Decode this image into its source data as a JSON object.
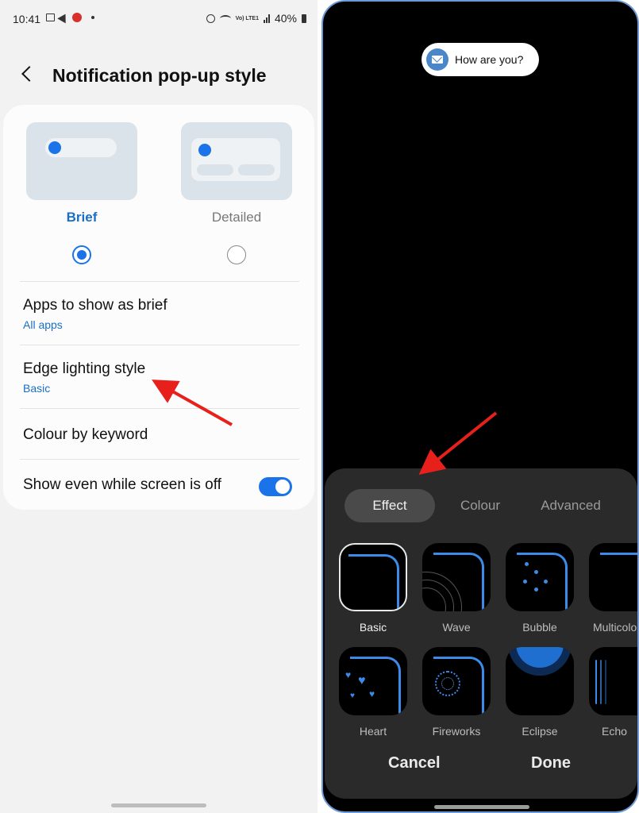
{
  "left_screen": {
    "status_bar": {
      "time": "10:41",
      "battery": "40%",
      "network": "Vo) LTE1"
    },
    "header": {
      "title": "Notification pop-up style"
    },
    "styles": [
      {
        "label": "Brief",
        "selected": true
      },
      {
        "label": "Detailed",
        "selected": false
      }
    ],
    "settings": [
      {
        "title": "Apps to show as brief",
        "subtitle": "All apps"
      },
      {
        "title": "Edge lighting style",
        "subtitle": "Basic"
      },
      {
        "title": "Colour by keyword"
      },
      {
        "title": "Show even while screen is off",
        "toggle": true
      }
    ]
  },
  "right_screen": {
    "preview_notification": "How are you?",
    "tabs": [
      "Effect",
      "Colour",
      "Advanced"
    ],
    "active_tab": "Effect",
    "effects": [
      "Basic",
      "Wave",
      "Bubble",
      "Multicolo",
      "Heart",
      "Fireworks",
      "Eclipse",
      "Echo"
    ],
    "selected_effect": "Basic",
    "buttons": {
      "cancel": "Cancel",
      "done": "Done"
    }
  },
  "colors": {
    "accent": "#1a73e8",
    "annotation_arrow": "#e8201c",
    "sheet_bg": "#2a2a2a",
    "edge_light": "#3d8be8"
  }
}
